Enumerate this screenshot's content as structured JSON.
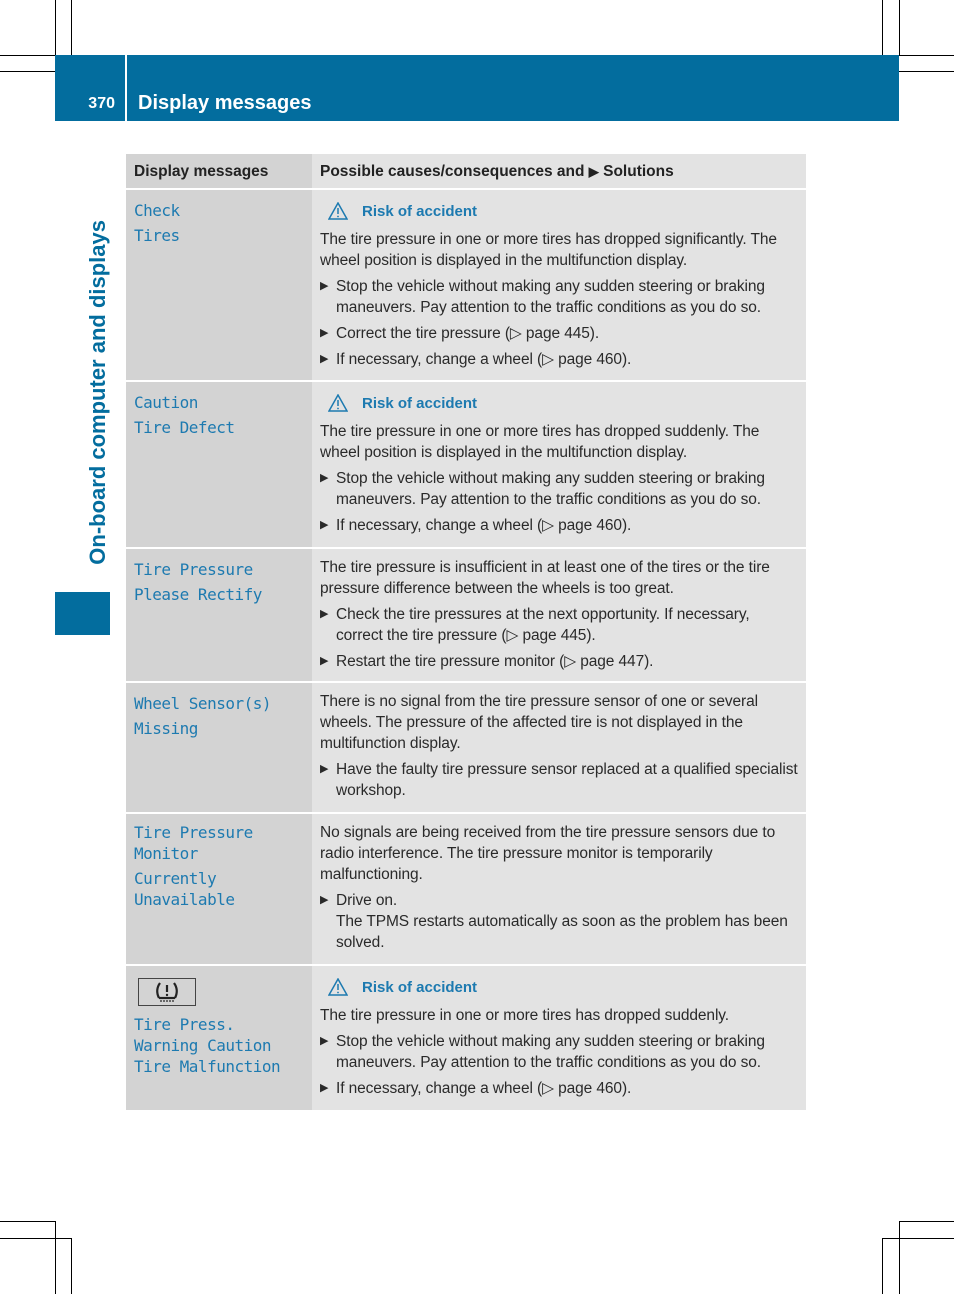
{
  "header": {
    "page_number": "370",
    "title": "Display messages"
  },
  "side_label": "On-board computer and displays",
  "table": {
    "columns": {
      "left": "Display messages",
      "right_prefix": "Possible causes/consequences and",
      "right_suffix": "Solutions"
    },
    "rows": [
      {
        "message": [
          "Check",
          "Tires"
        ],
        "risk": "Risk of accident",
        "paragraph": "The tire pressure in one or more tires has dropped significantly. The wheel position is displayed in the multifunction display.",
        "bullets": [
          "Stop the vehicle without making any sudden steering or braking maneuvers. Pay attention to the traffic conditions as you do so.",
          "Correct the tire pressure (▷ page 445).",
          "If necessary, change a wheel (▷ page 460)."
        ]
      },
      {
        "message": [
          "Caution",
          "Tire Defect"
        ],
        "risk": "Risk of accident",
        "paragraph": "The tire pressure in one or more tires has dropped suddenly. The wheel position is displayed in the multifunction display.",
        "bullets": [
          "Stop the vehicle without making any sudden steering or braking maneuvers. Pay attention to the traffic conditions as you do so.",
          "If necessary, change a wheel (▷ page 460)."
        ]
      },
      {
        "message": [
          "Tire Pressure",
          "Please Rectify"
        ],
        "paragraph": "The tire pressure is insufficient in at least one of the tires or the tire pressure difference between the wheels is too great.",
        "bullets": [
          "Check the tire pressures at the next opportunity. If necessary, correct the tire pressure (▷ page 445).",
          "Restart the tire pressure monitor (▷ page 447)."
        ]
      },
      {
        "message": [
          "Wheel Sensor(s)",
          "Missing"
        ],
        "paragraph": "There is no signal from the tire pressure sensor of one or several wheels. The pressure of the affected tire is not displayed in the multifunction display.",
        "bullets": [
          "Have the faulty tire pressure sensor replaced at a qualified specialist workshop."
        ]
      },
      {
        "message": [
          "Tire Pressure",
          "Monitor",
          "Currently",
          "Unavailable"
        ],
        "paragraph": "No signals are being received from the tire pressure sensors due to radio interference. The tire pressure monitor is temporarily malfunctioning.",
        "bullets": [
          "Drive on."
        ],
        "bullet_note": "The TPMS restarts automatically as soon as the problem has been solved."
      },
      {
        "icon": "tire-pressure-warning-icon",
        "message": [
          "Tire Press.",
          "Warning Caution",
          "Tire Malfunction"
        ],
        "risk": "Risk of accident",
        "paragraph": "The tire pressure in one or more tires has dropped suddenly.",
        "bullets": [
          "Stop the vehicle without making any sudden steering or braking maneuvers. Pay attention to the traffic conditions as you do so.",
          "If necessary, change a wheel (▷ page 460)."
        ]
      }
    ]
  },
  "colors": {
    "brand_blue": "#036d9e",
    "message_blue": "#1d7ab0",
    "left_col_bg": "#d3d3d3",
    "right_col_bg": "#e3e3e3"
  }
}
